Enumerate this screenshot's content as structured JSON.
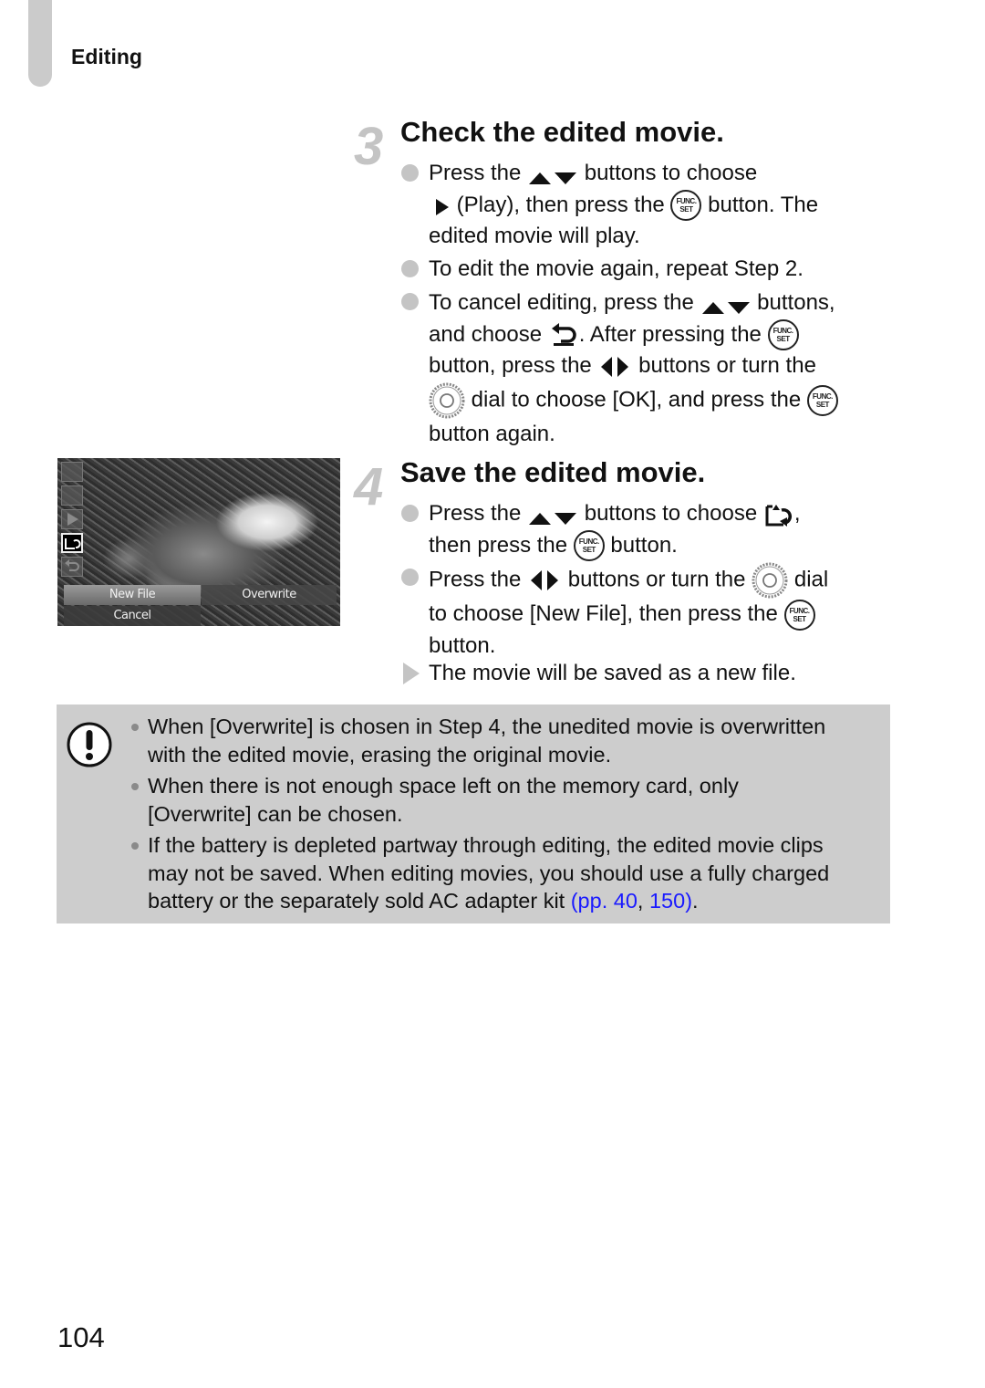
{
  "header": {
    "section_label": "Editing"
  },
  "steps": [
    {
      "number": "3",
      "title": "Check the edited movie.",
      "items": [
        {
          "type": "bullet",
          "lines": [
            [
              "Press the ",
              "{updown-icon}",
              " buttons to choose"
            ],
            [
              "{play-icon}",
              " (Play), then press the ",
              "{func-set-icon}",
              " button. The"
            ],
            [
              "edited movie will play."
            ]
          ]
        },
        {
          "type": "bullet",
          "lines": [
            [
              "To edit the movie again, repeat Step 2."
            ]
          ]
        },
        {
          "type": "bullet",
          "lines": [
            [
              "To cancel editing, press the ",
              "{updown-icon}",
              " buttons,"
            ],
            [
              "and choose ",
              "{undo-icon}",
              ". After pressing the ",
              "{func-set-icon}"
            ],
            [
              "button, press the ",
              "{leftright-icon}",
              " buttons or turn the"
            ],
            [
              "{dial-icon}",
              " dial to choose [OK], and press the ",
              "{func-set-icon}"
            ],
            [
              "button again."
            ]
          ]
        }
      ]
    },
    {
      "number": "4",
      "title": "Save the edited movie.",
      "items": [
        {
          "type": "bullet",
          "lines": [
            [
              "Press the ",
              "{updown-icon}",
              " buttons to choose ",
              "{new-file-icon}",
              ","
            ],
            [
              "then press the ",
              "{func-set-icon}",
              " button."
            ]
          ]
        },
        {
          "type": "bullet",
          "lines": [
            [
              "Press the ",
              "{leftright-icon}",
              " buttons or turn the ",
              "{dial-icon}",
              " dial"
            ],
            [
              "to choose [New File], then press the ",
              "{func-set-icon}"
            ],
            [
              "button."
            ]
          ]
        },
        {
          "type": "result",
          "lines": [
            [
              "The movie will be saved as a new file."
            ]
          ]
        }
      ]
    }
  ],
  "screen_thumbnail": {
    "side_icons": [
      "cut-start-icon",
      "cut-end-icon",
      "play-icon",
      "save-new-file-icon",
      "cancel-undo-icon"
    ],
    "active_icon": "save-new-file-icon",
    "buttons": {
      "new_file": "New File",
      "overwrite": "Overwrite",
      "cancel": "Cancel"
    },
    "selected_button": "New File"
  },
  "notice": {
    "icon": "caution-icon",
    "items": [
      {
        "lines": [
          "When [Overwrite] is chosen in Step 4, the unedited movie is overwritten",
          "with the edited movie, erasing the original movie."
        ]
      },
      {
        "lines": [
          "When there is not enough space left on the memory card, only",
          "[Overwrite] can be chosen."
        ]
      },
      {
        "lines": [
          "If the battery is depleted partway through editing, the edited movie clips",
          "may not be saved. When editing movies, you should use a fully charged",
          "battery or the separately sold AC adapter kit "
        ],
        "link_open": "(pp. ",
        "link_page_1": "40",
        "link_sep": ", ",
        "link_page_2": "150",
        "link_close": ")",
        "trailing": "."
      }
    ]
  },
  "colors": {
    "link": "#1a1aff",
    "notice_bg": "#cdcdcd",
    "accent_gray": "#c4c4c4"
  },
  "footer": {
    "page_number": "104"
  }
}
